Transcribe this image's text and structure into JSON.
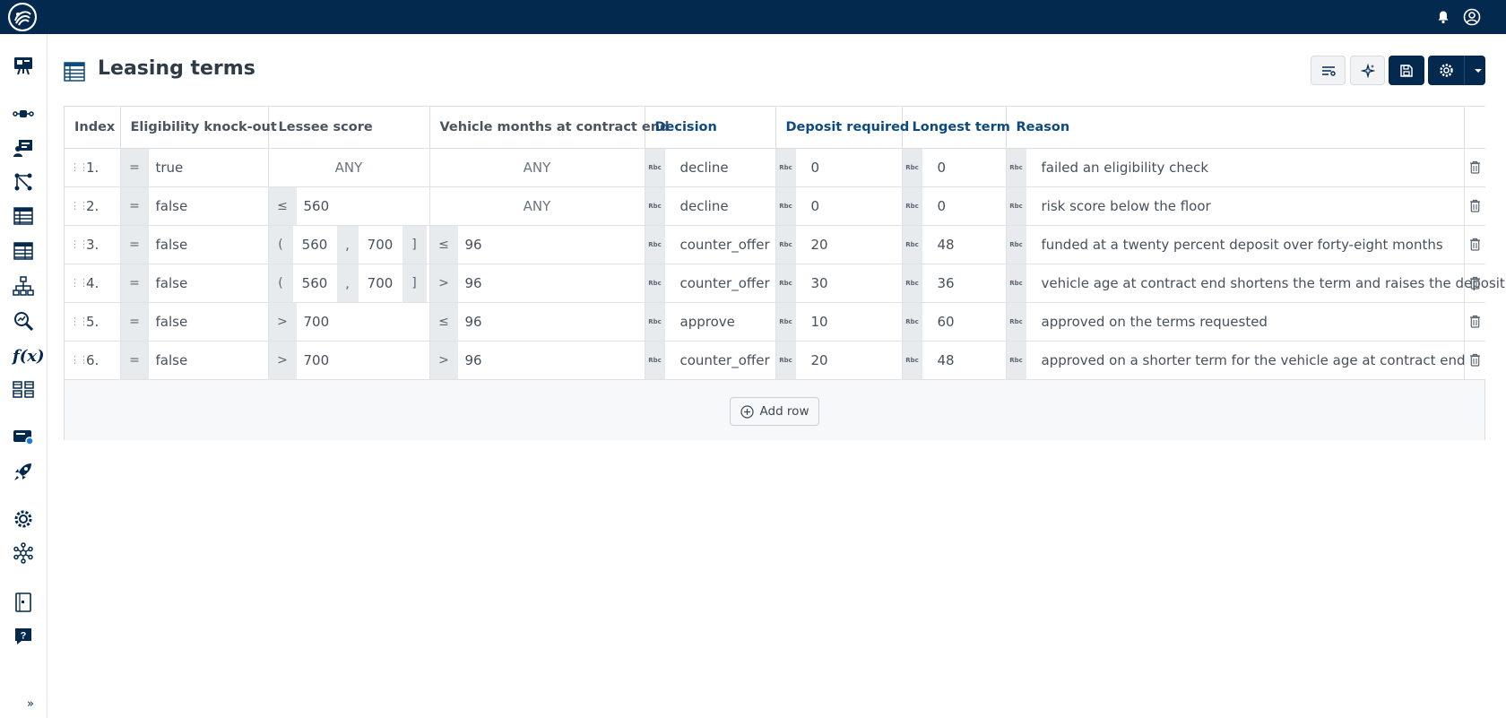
{
  "header": {
    "logo_icon": "brand-logo",
    "notification_icon": "bell-icon",
    "account_icon": "user-circle-icon"
  },
  "sidebar": {
    "items": [
      {
        "icon": "dashboard-presentation-icon"
      },
      {
        "icon": "flow-nodes-icon"
      },
      {
        "icon": "user-board-icon"
      },
      {
        "icon": "branching-icon"
      },
      {
        "icon": "decision-table-icon"
      },
      {
        "icon": "decision-table-alt-icon"
      },
      {
        "icon": "hierarchy-icon"
      },
      {
        "icon": "search-analytics-icon"
      },
      {
        "icon": "function-icon",
        "text": "f(x)"
      },
      {
        "icon": "data-model-icon"
      },
      {
        "icon": "deployment-icon"
      },
      {
        "icon": "rocket-icon"
      },
      {
        "icon": "settings-gear-icon"
      },
      {
        "icon": "network-icon"
      },
      {
        "icon": "document-icon"
      },
      {
        "icon": "help-icon"
      }
    ],
    "expand_label": "»"
  },
  "page": {
    "title": "Leasing terms",
    "title_icon": "decision-table-icon"
  },
  "toolbar": {
    "buttons": [
      "filter-settings-icon",
      "ai-sparkle-icon",
      "save-icon",
      "settings-gear-icon",
      "dropdown-caret-icon"
    ]
  },
  "table": {
    "columns": [
      {
        "label": "Index",
        "kind": "index"
      },
      {
        "label": "Eligibility knock-out",
        "kind": "input"
      },
      {
        "label": "Lessee score",
        "kind": "input"
      },
      {
        "label": "Vehicle months at contract end",
        "kind": "input"
      },
      {
        "label": "Decision",
        "kind": "output"
      },
      {
        "label": "Deposit required",
        "kind": "output"
      },
      {
        "label": "Longest term",
        "kind": "output"
      },
      {
        "label": "Reason",
        "kind": "output"
      }
    ],
    "type_badge": "Rbc",
    "any_label": "ANY",
    "rows": [
      {
        "index": "1.",
        "knockout": {
          "op": "=",
          "val": "true"
        },
        "score": {
          "any": true
        },
        "months": {
          "any": true
        },
        "decision": "decline",
        "deposit": "0",
        "term": "0",
        "reason": "failed an eligibility check"
      },
      {
        "index": "2.",
        "knockout": {
          "op": "=",
          "val": "false"
        },
        "score": {
          "op": "≤",
          "val": "560"
        },
        "months": {
          "any": true
        },
        "decision": "decline",
        "deposit": "0",
        "term": "0",
        "reason": "risk score below the floor"
      },
      {
        "index": "3.",
        "knockout": {
          "op": "=",
          "val": "false"
        },
        "score": {
          "range": [
            "(",
            "560",
            ",",
            "700",
            "]"
          ]
        },
        "months": {
          "op": "≤",
          "val": "96"
        },
        "decision": "counter_offer",
        "deposit": "20",
        "term": "48",
        "reason": "funded at a twenty percent deposit over forty-eight months"
      },
      {
        "index": "4.",
        "knockout": {
          "op": "=",
          "val": "false"
        },
        "score": {
          "range": [
            "(",
            "560",
            ",",
            "700",
            "]"
          ]
        },
        "months": {
          "op": ">",
          "val": "96"
        },
        "decision": "counter_offer",
        "deposit": "30",
        "term": "36",
        "reason": "vehicle age at contract end shortens the term and raises the deposit"
      },
      {
        "index": "5.",
        "knockout": {
          "op": "=",
          "val": "false"
        },
        "score": {
          "op": ">",
          "val": "700"
        },
        "months": {
          "op": "≤",
          "val": "96"
        },
        "decision": "approve",
        "deposit": "10",
        "term": "60",
        "reason": "approved on the terms requested"
      },
      {
        "index": "6.",
        "knockout": {
          "op": "=",
          "val": "false"
        },
        "score": {
          "op": ">",
          "val": "700"
        },
        "months": {
          "op": ">",
          "val": "96"
        },
        "decision": "counter_offer",
        "deposit": "20",
        "term": "48",
        "reason": "approved on a shorter term for the vehicle age at contract end"
      }
    ],
    "add_row_label": "Add row"
  }
}
